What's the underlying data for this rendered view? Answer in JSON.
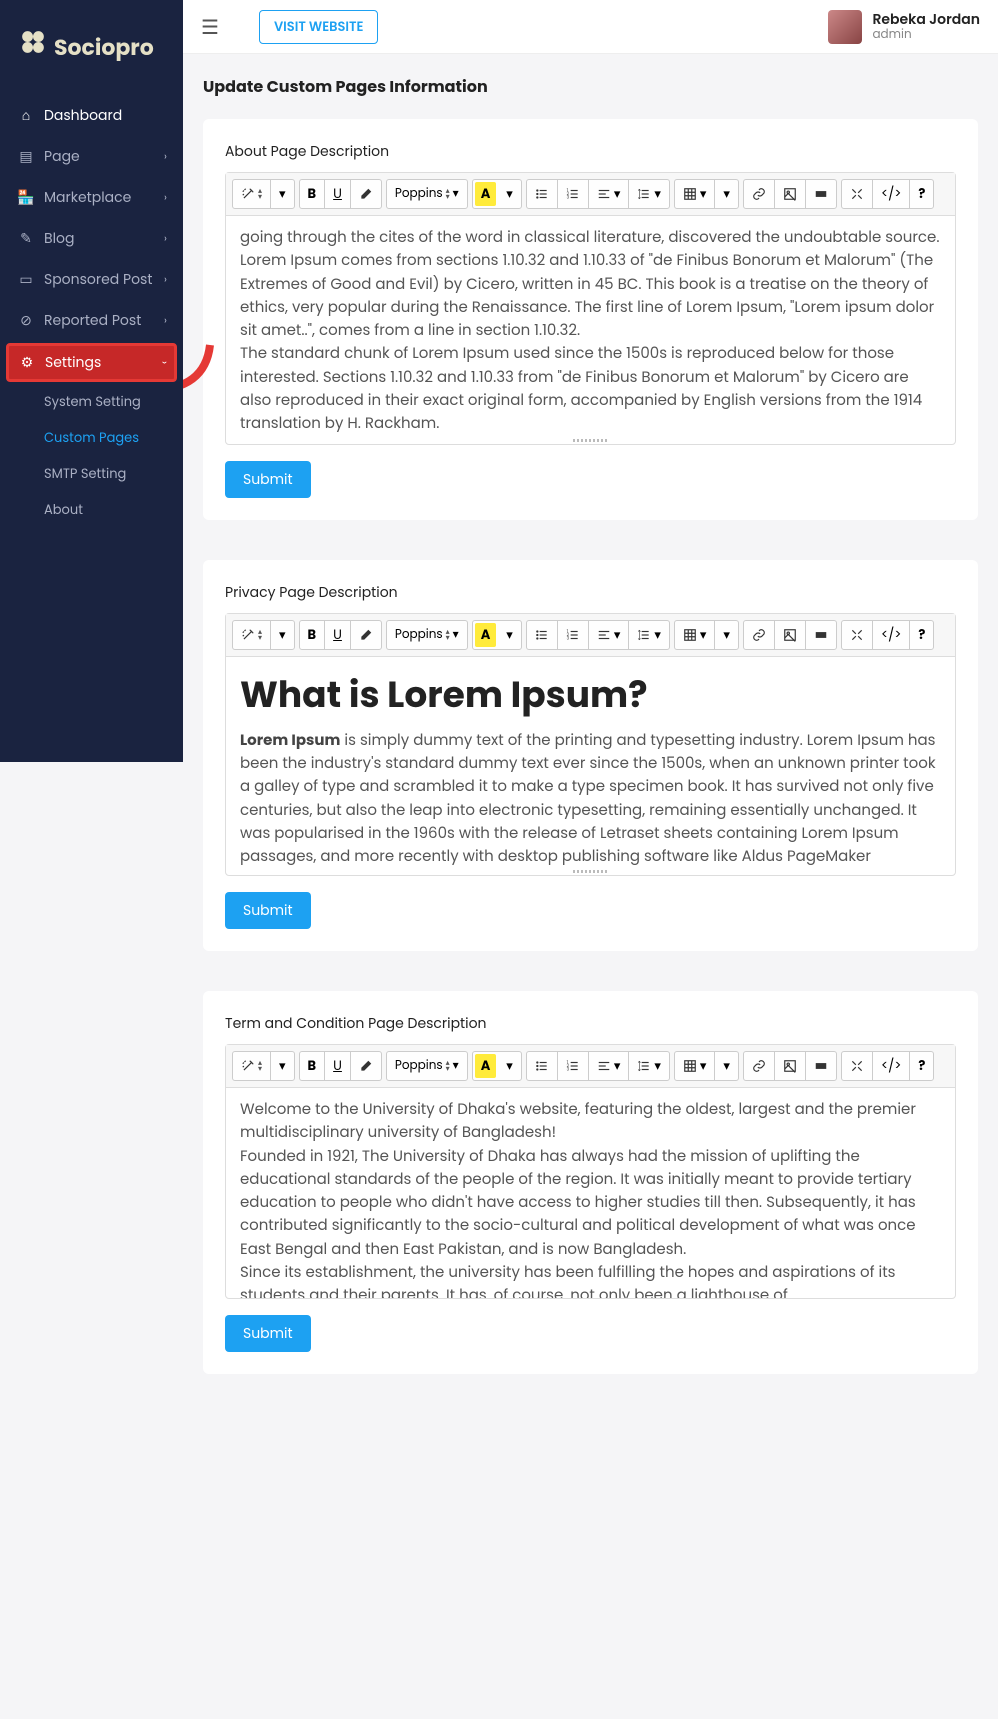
{
  "brand": "Sociopro",
  "topbar": {
    "visit": "VISIT WEBSITE",
    "user_name": "Rebeka Jordan",
    "user_role": "admin"
  },
  "sidebar": {
    "dashboard": "Dashboard",
    "page": "Page",
    "marketplace": "Marketplace",
    "blog": "Blog",
    "sponsored": "Sponsored Post",
    "reported": "Reported Post",
    "settings": "Settings",
    "sub_system": "System Setting",
    "sub_custom": "Custom Pages",
    "sub_smtp": "SMTP Setting",
    "sub_about": "About"
  },
  "page_title": "Update Custom Pages Information",
  "font_name": "Poppins",
  "about": {
    "label": "About Page Description",
    "content": "going through the cites of the word in classical literature, discovered the undoubtable source. Lorem Ipsum comes from sections 1.10.32 and 1.10.33 of \"de Finibus Bonorum et Malorum\" (The Extremes of Good and Evil) by Cicero, written in 45 BC. This book is a treatise on the theory of ethics, very popular during the Renaissance. The first line of Lorem Ipsum, \"Lorem ipsum dolor sit amet..\", comes from a line in section 1.10.32.\nThe standard chunk of Lorem Ipsum used since the 1500s is reproduced below for those interested. Sections 1.10.32 and 1.10.33 from \"de Finibus Bonorum et Malorum\" by Cicero are also reproduced in their exact original form, accompanied by English versions from the 1914 translation by H. Rackham.",
    "submit": "Submit"
  },
  "privacy": {
    "label": "Privacy Page Description",
    "heading": "What is Lorem Ipsum?",
    "strong": "Lorem Ipsum",
    "content": " is simply dummy text of the printing and typesetting industry. Lorem Ipsum has been the industry's standard dummy text ever since the 1500s, when an unknown printer took a galley of type and scrambled it to make a type specimen book. It has survived not only five centuries, but also the leap into electronic typesetting, remaining essentially unchanged. It was popularised in the 1960s with the release of Letraset sheets containing Lorem Ipsum passages, and more recently with desktop publishing software like Aldus PageMaker including versions of Lorem Ipsum.",
    "submit": "Submit"
  },
  "terms": {
    "label": "Term and Condition Page Description",
    "content": "Welcome to the University of Dhaka's website, featuring the oldest, largest and the premier multidisciplinary university of Bangladesh!\nFounded in 1921, The University of Dhaka has always had the mission of uplifting the educational standards of the people of the region. It was initially meant to provide tertiary education to people who didn't have access to higher studies till then. Subsequently, it has contributed significantly to the socio-cultural and political development of what was once East Bengal and then East Pakistan, and is now Bangladesh.\nSince its establishment, the university has been fulfilling the hopes and aspirations of its students and their parents. It has, of course, not only been a lighthouse of",
    "submit": "Submit"
  }
}
